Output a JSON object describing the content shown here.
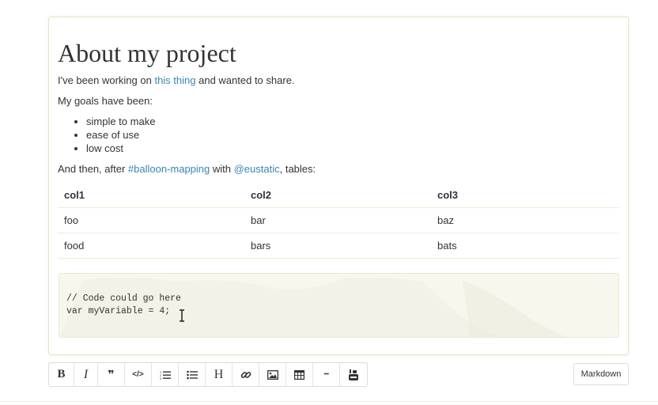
{
  "document": {
    "title": "About my project",
    "intro": {
      "before": "I've been working on ",
      "link": "this thing",
      "after": " and wanted to share."
    },
    "goals_heading": "My goals have been:",
    "goals": [
      "simple to make",
      "ease of use",
      "low cost"
    ],
    "outro": {
      "before": "And then, after ",
      "tag": "#balloon-mapping",
      "middle": " with ",
      "mention": "@eustatic",
      "after": ", tables:"
    },
    "table": {
      "headers": [
        "col1",
        "col2",
        "col3"
      ],
      "rows": [
        [
          "foo",
          "bar",
          "baz"
        ],
        [
          "food",
          "bars",
          "bats"
        ]
      ]
    },
    "code_lines": [
      "// Code could go here",
      "var myVariable = 4;"
    ]
  },
  "toolbar": {
    "buttons": [
      {
        "name": "bold",
        "glyph": "B"
      },
      {
        "name": "italic",
        "glyph": "I"
      },
      {
        "name": "quote",
        "glyph": "❞"
      },
      {
        "name": "code",
        "glyph": "</>"
      },
      {
        "name": "ordered-list",
        "glyph": ""
      },
      {
        "name": "unordered-list",
        "glyph": ""
      },
      {
        "name": "heading",
        "glyph": "H"
      },
      {
        "name": "link",
        "glyph": ""
      },
      {
        "name": "image",
        "glyph": ""
      },
      {
        "name": "table",
        "glyph": ""
      },
      {
        "name": "more",
        "glyph": "•••"
      },
      {
        "name": "youtube",
        "glyph": ""
      }
    ],
    "mode_label": "Markdown"
  },
  "colors": {
    "link": "#3a86b4",
    "code_background": "#f7f7ee",
    "border": "#dcdcdc"
  }
}
